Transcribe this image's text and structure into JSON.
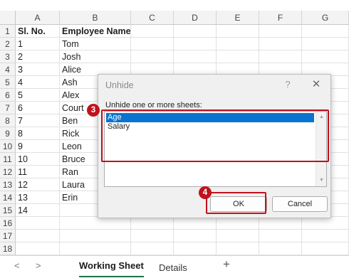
{
  "columns": [
    "A",
    "B",
    "C",
    "D",
    "E",
    "F",
    "G"
  ],
  "rows": [
    {
      "n": "1",
      "a": "Sl. No.",
      "b": "Employee Name",
      "bold": true
    },
    {
      "n": "2",
      "a": "1",
      "b": "Tom"
    },
    {
      "n": "3",
      "a": "2",
      "b": "Josh"
    },
    {
      "n": "4",
      "a": "3",
      "b": "Alice"
    },
    {
      "n": "5",
      "a": "4",
      "b": "Ash"
    },
    {
      "n": "6",
      "a": "5",
      "b": "Alex"
    },
    {
      "n": "7",
      "a": "6",
      "b": "Court"
    },
    {
      "n": "8",
      "a": "7",
      "b": "Ben"
    },
    {
      "n": "9",
      "a": "8",
      "b": "Rick"
    },
    {
      "n": "10",
      "a": "9",
      "b": "Leon"
    },
    {
      "n": "11",
      "a": "10",
      "b": "Bruce"
    },
    {
      "n": "12",
      "a": "11",
      "b": "Ran"
    },
    {
      "n": "13",
      "a": "12",
      "b": "Laura"
    },
    {
      "n": "14",
      "a": "13",
      "b": "Erin"
    },
    {
      "n": "15",
      "a": "14",
      "b": ""
    },
    {
      "n": "16",
      "a": "",
      "b": ""
    },
    {
      "n": "17",
      "a": "",
      "b": ""
    },
    {
      "n": "18",
      "a": "",
      "b": ""
    }
  ],
  "dialog": {
    "title": "Unhide",
    "help": "?",
    "close": "✕",
    "label": "Unhide one or more sheets:",
    "sheets": [
      "Age",
      "Salary"
    ],
    "selected": "Age",
    "ok": "OK",
    "cancel": "Cancel"
  },
  "steps": {
    "list": "3",
    "ok": "4"
  },
  "tabs": {
    "prev": "<",
    "next": ">",
    "items": [
      "Working Sheet",
      "Details"
    ],
    "active": "Working Sheet",
    "add": "+"
  },
  "colors": {
    "accent": "#c0121c",
    "selection": "#0a74d0",
    "active_tab": "#1e7145"
  }
}
